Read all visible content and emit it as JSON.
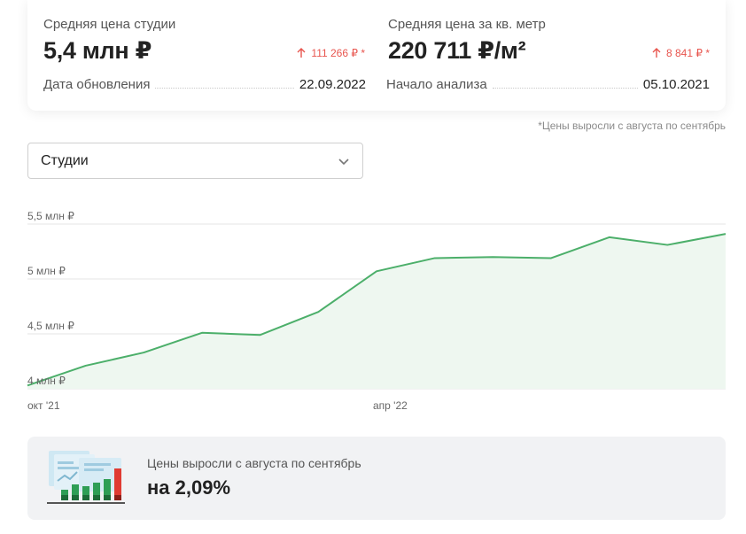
{
  "stats": {
    "studio_price": {
      "label": "Средняя цена студии",
      "value": "5,4 млн ₽",
      "delta": "111 266 ₽ *"
    },
    "sqm_price": {
      "label": "Средняя цена за кв. метр",
      "value": "220 711 ₽/м²",
      "delta": "8 841 ₽ *"
    },
    "update_date": {
      "label": "Дата обновления",
      "value": "22.09.2022"
    },
    "analysis_start": {
      "label": "Начало анализа",
      "value": "05.10.2021"
    }
  },
  "footnote": "*Цены выросли с августа по сентябрь",
  "filter": {
    "selected": "Студии"
  },
  "colors": {
    "line": "#4caf6a",
    "area": "#eef7f0",
    "delta": "#e8554e",
    "grid": "#e6e6e6"
  },
  "chart_data": {
    "type": "area",
    "x": [
      "2021-10",
      "2021-11",
      "2021-12",
      "2022-01",
      "2022-02",
      "2022-03",
      "2022-04",
      "2022-05",
      "2022-06",
      "2022-07",
      "2022-08",
      "2022-09"
    ],
    "series": [
      {
        "values": [
          4.03,
          4.21,
          4.33,
          4.51,
          4.49,
          4.7,
          5.07,
          5.19,
          5.2,
          5.19,
          5.38,
          5.31,
          5.41
        ]
      }
    ],
    "x_points": [
      "2021-10-05",
      "2021-11",
      "2021-12",
      "2022-01",
      "2022-02",
      "2022-03",
      "2022-04",
      "2022-05",
      "2022-06",
      "2022-07",
      "2022-08",
      "2022-09",
      "2022-09-22"
    ],
    "yticks": [
      {
        "value": 4.0,
        "label": "4 млн ₽"
      },
      {
        "value": 4.5,
        "label": "4,5 млн ₽"
      },
      {
        "value": 5.0,
        "label": "5 млн ₽"
      },
      {
        "value": 5.5,
        "label": "5,5 млн ₽"
      }
    ],
    "xticks": [
      {
        "value": "2021-10",
        "label": "окт '21"
      },
      {
        "value": "2022-04",
        "label": "апр '22"
      }
    ],
    "ylim": [
      4.0,
      5.5
    ],
    "grid": true
  },
  "summary": {
    "text": "Цены выросли с августа по сентябрь",
    "value": "на 2,09%"
  }
}
